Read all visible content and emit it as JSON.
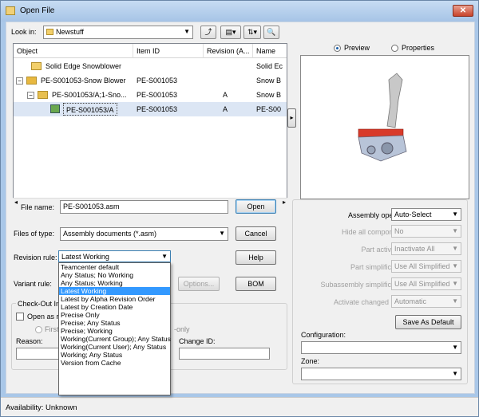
{
  "window": {
    "title": "Open File",
    "close_label": "✕"
  },
  "lookin": {
    "label": "Look in:",
    "value": "Newstuff"
  },
  "grid": {
    "columns": [
      "Object",
      "Item ID",
      "Revision (A...",
      "Name"
    ],
    "rows": [
      {
        "object": "Solid Edge Snowblower",
        "item_id": "",
        "revision": "",
        "name": "Solid Ec"
      },
      {
        "object": "PE-S001053-Snow Blower",
        "item_id": "PE-S001053",
        "revision": "",
        "name": "Snow B"
      },
      {
        "object": "PE-S001053/A;1-Sno...",
        "item_id": "PE-S001053",
        "revision": "A",
        "name": "Snow B"
      },
      {
        "object": "PE-S001053/A",
        "item_id": "PE-S001053",
        "revision": "A",
        "name": "PE-S00"
      }
    ]
  },
  "preview": {
    "preview_label": "Preview",
    "properties_label": "Properties"
  },
  "file_name": {
    "label": "File name:",
    "value": "PE-S001053.asm"
  },
  "files_of_type": {
    "label": "Files of type:",
    "value": "Assembly documents (*.asm)"
  },
  "revision_rule": {
    "label": "Revision rule:",
    "value": "Latest Working",
    "options": [
      "Teamcenter default",
      "Any Status; No Working",
      "Any Status; Working",
      "Latest Working",
      "Latest by Alpha Revision Order",
      "Latest by Creation Date",
      "Precise Only",
      "Precise; Any Status",
      "Precise; Working",
      "Working(Current Group); Any Status",
      "Working(Current User); Any Status",
      "Working; Any Status",
      "Version from Cache"
    ],
    "selected_index": 3
  },
  "variant_rule": {
    "label": "Variant rule:"
  },
  "buttons": {
    "open": "Open",
    "cancel": "Cancel",
    "help": "Help",
    "options": "Options...",
    "bom": "BOM",
    "save_default": "Save As Default"
  },
  "checkout": {
    "group_label": "Check-Out Inf",
    "open_as_label": "Open as r",
    "first_label": "First",
    "readonly_label": "-only",
    "reason_label": "Reason:",
    "change_id_label": "Change ID:"
  },
  "assembly": {
    "open_as_label": "Assembly open as:",
    "open_as_value": "Auto-Select",
    "hide_label": "Hide all components:",
    "hide_value": "No",
    "part_activation_label": "Part activation:",
    "part_activation_value": "Inactivate All",
    "part_simplification_label": "Part simplification:",
    "part_simplification_value": "Use All Simplified",
    "subassembly_label": "Subassembly simplification:",
    "subassembly_value": "Use All Simplified",
    "activate_changed_label": "Activate changed parts:",
    "activate_changed_value": "Automatic"
  },
  "configuration": {
    "label": "Configuration:",
    "value": ""
  },
  "zone": {
    "label": "Zone:",
    "value": ""
  },
  "status": {
    "text": "Availability: Unknown"
  }
}
